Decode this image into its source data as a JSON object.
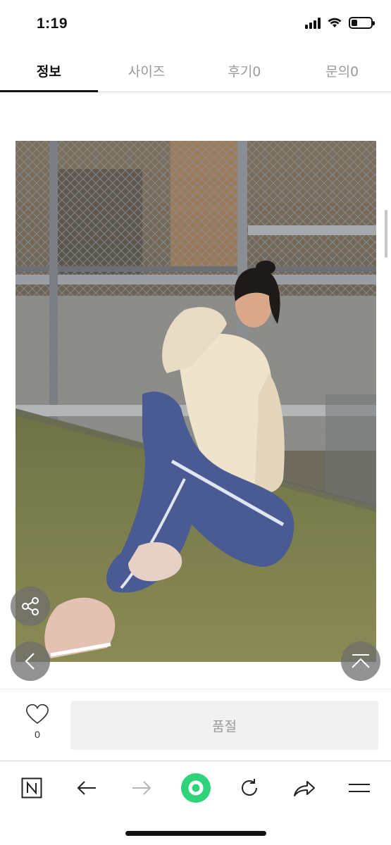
{
  "status_bar": {
    "time": "1:19",
    "battery_level": 0.3
  },
  "tabs": [
    {
      "label": "정보",
      "active": true
    },
    {
      "label": "사이즈",
      "active": false
    },
    {
      "label": "후기0",
      "active": false
    },
    {
      "label": "문의0",
      "active": false
    }
  ],
  "product": {
    "image_icon": "product-photo",
    "colors": {
      "hoodie": "#efe3cc",
      "leggings": "#4a5a92",
      "turf": "#7a7d47"
    }
  },
  "action_bar": {
    "wish_count": "0",
    "soldout_label": "품절"
  },
  "browser_toolbar": {
    "icons": [
      "naver-icon",
      "back-arrow-icon",
      "forward-arrow-icon",
      "green-circle-icon",
      "refresh-icon",
      "share-icon",
      "menu-icon"
    ],
    "accent_color": "#2fd37a"
  }
}
